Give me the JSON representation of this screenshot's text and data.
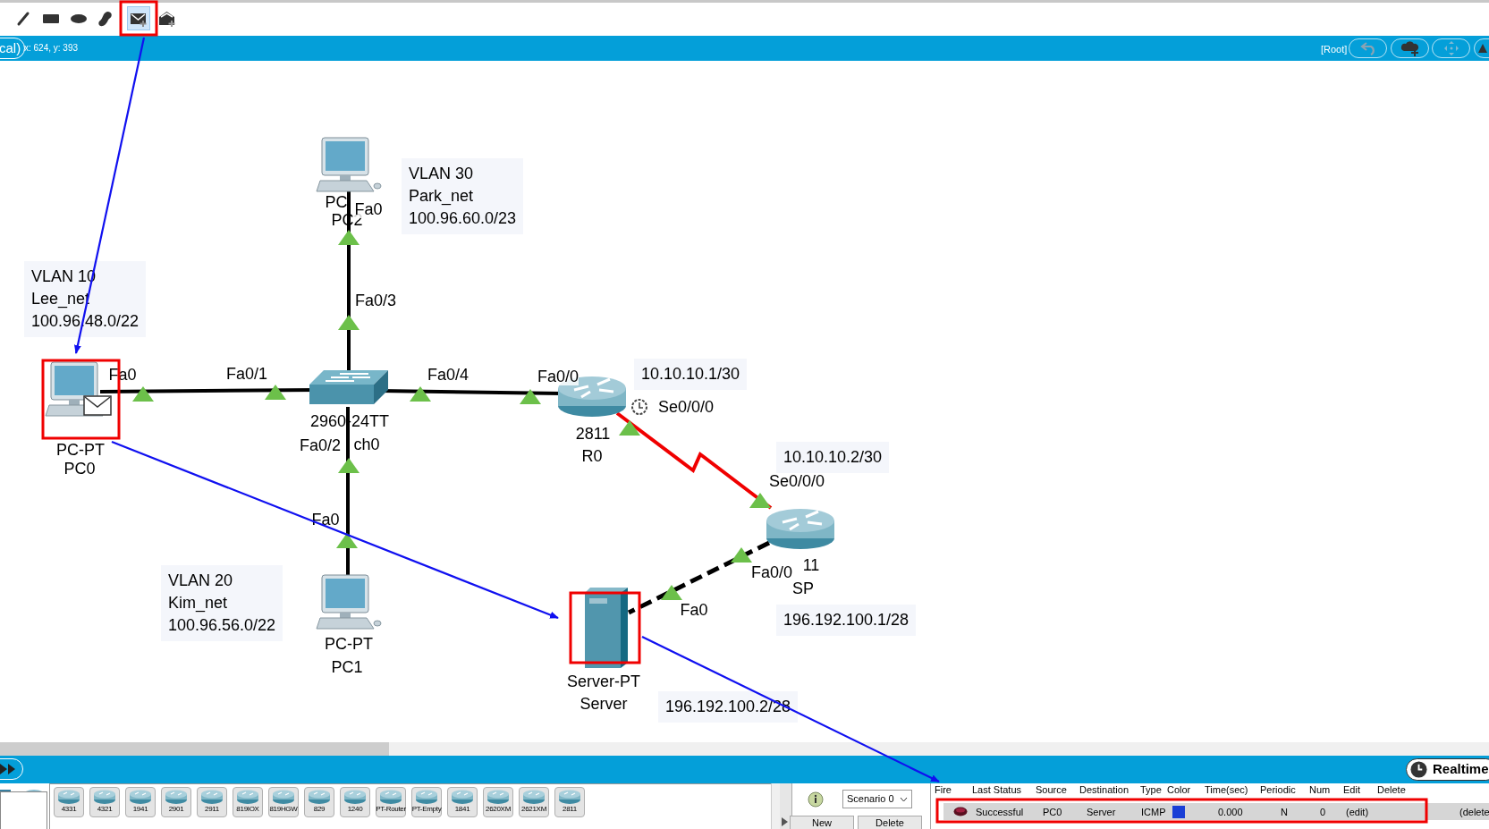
{
  "toolbar": {
    "tools": [
      {
        "kind": "line",
        "selected": false
      },
      {
        "kind": "rectangle",
        "selected": false
      },
      {
        "kind": "ellipse",
        "selected": false
      },
      {
        "kind": "freeform",
        "selected": false
      },
      {
        "kind": "simple_pdu",
        "selected": true
      },
      {
        "kind": "complex_pdu",
        "selected": false
      }
    ]
  },
  "nav_bar": {
    "view_tab": "cal)",
    "coordinates": "x: 624, y: 393",
    "breadcrumb": "[Root]"
  },
  "canvas": {
    "notes": [
      {
        "lines": [
          "VLAN 30",
          "Park_net",
          "100.96.60.0/23"
        ]
      },
      {
        "lines": [
          "VLAN 10",
          "Lee_net",
          "100.96.48.0/22"
        ]
      },
      {
        "lines": [
          "VLAN 20",
          "Kim_net",
          "100.96.56.0/22"
        ]
      },
      {
        "lines": [
          "10.10.10.1/30"
        ]
      },
      {
        "lines": [
          "10.10.10.2/30"
        ]
      },
      {
        "lines": [
          "196.192.100.1/28"
        ]
      },
      {
        "lines": [
          "196.192.100.2/28"
        ]
      }
    ],
    "devices": [
      {
        "kind": "pc",
        "model": "PC",
        "name": "PC2"
      },
      {
        "kind": "pc",
        "model": "PC-PT",
        "name": "PC0"
      },
      {
        "kind": "switch",
        "model": "2960-24TT",
        "name": "ch0"
      },
      {
        "kind": "router",
        "model": "2811",
        "name": "R0"
      },
      {
        "kind": "router",
        "model": "11",
        "name": "SP"
      },
      {
        "kind": "server",
        "model": "Server-PT",
        "name": "Server"
      },
      {
        "kind": "pc",
        "model": "PC-PT",
        "name": "PC1"
      }
    ],
    "links": [
      {
        "kind": "copper"
      },
      {
        "kind": "copper"
      },
      {
        "kind": "copper"
      },
      {
        "kind": "copper"
      },
      {
        "kind": "serial"
      },
      {
        "kind": "crossover"
      }
    ],
    "port_labels": [
      "Fa0",
      "Fa0/3",
      "Fa0",
      "Fa0/1",
      "Fa0/4",
      "Fa0/0",
      "Se0/0/0",
      "Fa0/2",
      "Fa0",
      "Se0/0/0",
      "Fa0/0",
      "Fa0"
    ]
  },
  "device_models": [
    "4331",
    "4321",
    "1941",
    "2901",
    "2911",
    "819IOX",
    "819HGW",
    "829",
    "1240",
    "PT-Router",
    "PT-Empty",
    "1841",
    "2620XM",
    "2621XM",
    "2811"
  ],
  "realtime_button": "Realtime",
  "scenario": {
    "selected": "Scenario 0",
    "buttons": [
      "New",
      "Delete"
    ]
  },
  "pdu_table": {
    "columns": [
      "Fire",
      "Last Status",
      "Source",
      "Destination",
      "Type",
      "Color",
      "Time(sec)",
      "Periodic",
      "Num",
      "Edit",
      "Delete"
    ],
    "rows": [
      {
        "last_status": "Successful",
        "source": "PC0",
        "destination": "Server",
        "type": "ICMP",
        "color": "#1a3fd6",
        "time": "0.000",
        "periodic": "N",
        "num": "0",
        "edit": "(edit)",
        "delete": "(delete"
      }
    ]
  }
}
